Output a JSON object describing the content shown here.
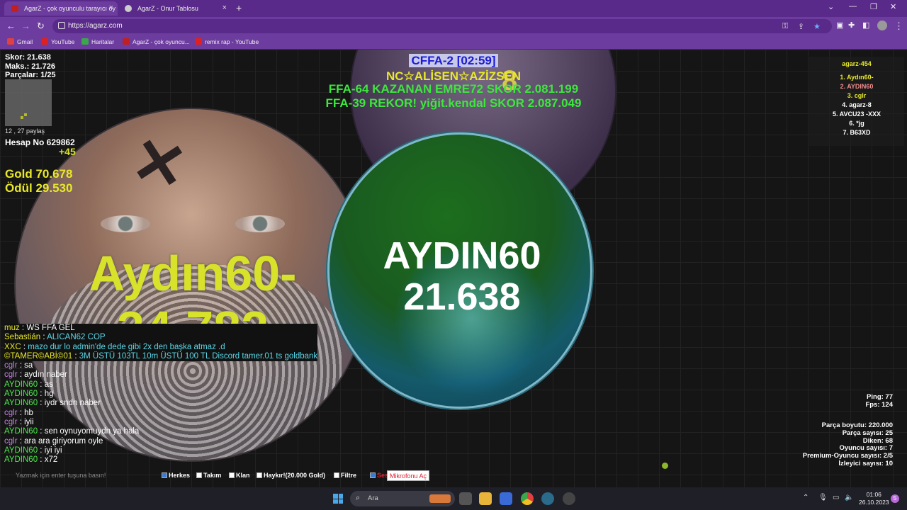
{
  "browser": {
    "tabs": [
      {
        "title": "AgarZ - çok oyunculu tarayıcı oy",
        "active": true
      },
      {
        "title": "AgarZ - Onur Tablosu",
        "active": false
      }
    ],
    "url": "https://agarz.com",
    "bookmarks": [
      "Gmail",
      "YouTube",
      "Haritalar",
      "AgarZ - çok oyuncu...",
      "remix rap - YouTube"
    ]
  },
  "stats": {
    "score": "Skor: 21.638",
    "max": "Maks.: 21.726",
    "parts": "Parçalar: 1/25",
    "share": "12 , 27 paylaş",
    "account": "Hesap No 629862",
    "plus": "+45",
    "gold": "Gold 70.678",
    "reward": "Ödül 29.530"
  },
  "headlines": {
    "timer": "CFFA-2 [02:59]",
    "nc": "NC☆ALİSEN☆AZİZSEN",
    "win": "FFA-64 KAZANAN EMRE72 SKOR 2.081.199",
    "record": "FFA-39 REKOR! yiğit.kendal SKOR 2.087.049"
  },
  "cells": {
    "top_partial": "8",
    "big": {
      "name": "Aydın60-",
      "mass": "34.782"
    },
    "me": {
      "name": "AYDIN60",
      "mass": "21.638"
    }
  },
  "leaderboard": {
    "title": "agarz-454",
    "rows": [
      "1. Aydın60-",
      "2. AYDIN60",
      "3. cglr",
      "4. agarz-8",
      "5. AVCU23  -XXX",
      "6. *jg",
      "7. B63XD"
    ],
    "colors": [
      "#e8e82a",
      "#f08a8a",
      "#e8e82a",
      "#ffffff",
      "#ffffff",
      "#ffffff",
      "#ffffff"
    ]
  },
  "chat": [
    {
      "who": "muz",
      "msg": "WS FFA GEL"
    },
    {
      "who": "Sebastián",
      "msg": "ALICAN62 COP"
    },
    {
      "who": "XXC",
      "msg": "mazo dur lo admin'de dede gibi 2x den başka atmaz .d"
    },
    {
      "who": "©TAMER©ABİ©01",
      "msg": "3M ÜSTÜ 103TL 10m ÜSTÜ 100 TL Discord tamer.01 ts goldbank"
    },
    {
      "who": "cglr",
      "msg": "sa"
    },
    {
      "who": "cglr",
      "msg": "aydın naber"
    },
    {
      "who": "AYDIN60",
      "msg": "as"
    },
    {
      "who": "AYDIN60",
      "msg": "hg"
    },
    {
      "who": "AYDIN60",
      "msg": "iydr sndn naber"
    },
    {
      "who": "cglr",
      "msg": "hb"
    },
    {
      "who": "cglr",
      "msg": "iyii"
    },
    {
      "who": "AYDIN60",
      "msg": "sen oynuyomuydn ya hala"
    },
    {
      "who": "cglr",
      "msg": "ara ara giriyorum oyle"
    },
    {
      "who": "AYDIN60",
      "msg": "iyi iyi"
    },
    {
      "who": "AYDIN60",
      "msg": "x72"
    }
  ],
  "chatbar": {
    "placeholder": "Yazmak için enter tuşuna basın!",
    "options": [
      {
        "label": "Herkes",
        "checked": true
      },
      {
        "label": "Takım",
        "checked": false
      },
      {
        "label": "Klan",
        "checked": false
      },
      {
        "label": "Haykır!(20.000 Gold)",
        "checked": false
      },
      {
        "label": "Filtre",
        "checked": false
      },
      {
        "label": "Ses",
        "checked": true
      }
    ],
    "mic": "Mikrofonu Aç"
  },
  "perf": {
    "ping": "Ping: 77",
    "fps": "Fps: 124"
  },
  "server": [
    "Parça boyutu: 220.000",
    "Parça sayısı: 25",
    "Diken: 68",
    "Oyuncu sayısı: 7",
    "Premium-Oyuncu sayısı: 2/5",
    "İzleyici sayısı: 10"
  ],
  "taskbar": {
    "search": "Ara",
    "time": "01:06",
    "date": "26.10.2023",
    "notifications": "5"
  }
}
